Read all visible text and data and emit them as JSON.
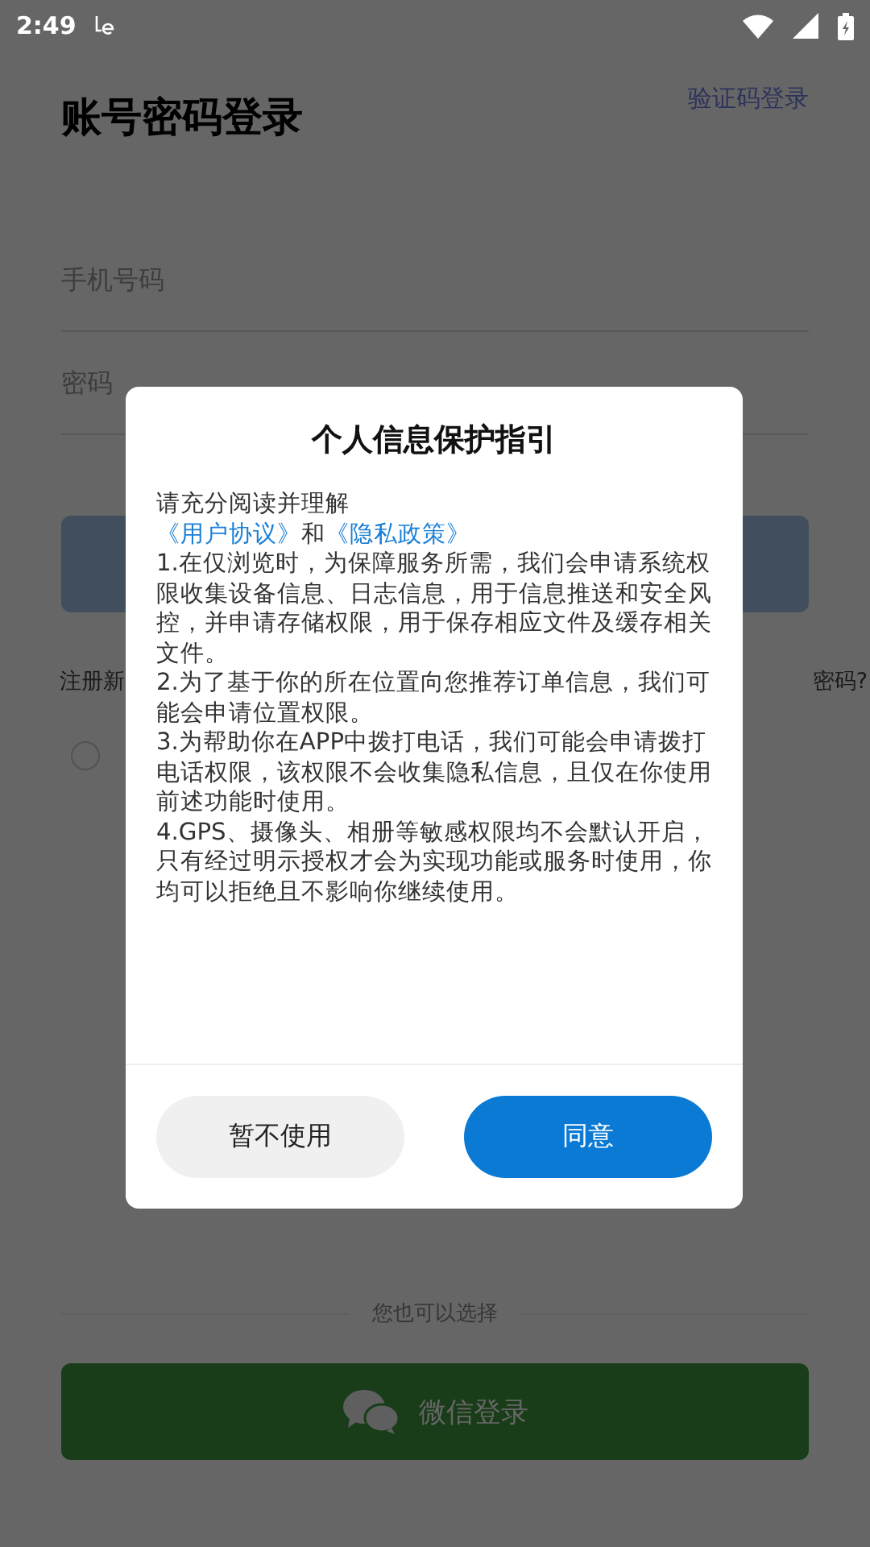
{
  "status_bar": {
    "time": "2:49"
  },
  "page": {
    "title": "账号密码登录",
    "switch_link": "验证码登录",
    "phone_placeholder": "手机号码",
    "password_placeholder": "密码",
    "register_text": "注册新",
    "forgot_text": "密码?",
    "agreement_radio": {
      "checked": false
    },
    "divider_text": "您也可以选择",
    "wechat_button": "微信登录"
  },
  "dialog": {
    "title": "个人信息保护指引",
    "intro": "请充分阅读并理解",
    "links_line": [
      {
        "kind": "link",
        "text": "《用户协议》"
      },
      {
        "kind": "plain",
        "text": "和"
      },
      {
        "kind": "link",
        "text": "《隐私政策》"
      }
    ],
    "paragraphs": [
      "1.在仅浏览时，为保障服务所需，我们会申请系统权限收集设备信息、日志信息，用于信息推送和安全风控，并申请存储权限，用于保存相应文件及缓存相关文件。",
      "2.为了基于你的所在位置向您推荐订单信息，我们可能会申请位置权限。",
      "3.为帮助你在APP中拨打电话，我们可能会申请拨打电话权限，该权限不会收集隐私信息，且仅在你使用前述功能时使用。",
      "4.GPS、摄像头、相册等敏感权限均不会默认开启，只有经过明示授权才会为实现功能或服务时使用，你均可以拒绝且不影响你继续使用。"
    ],
    "buttons": [
      {
        "kind": "secondary",
        "label": "暂不使用"
      },
      {
        "kind": "primary",
        "label": "同意"
      }
    ]
  }
}
